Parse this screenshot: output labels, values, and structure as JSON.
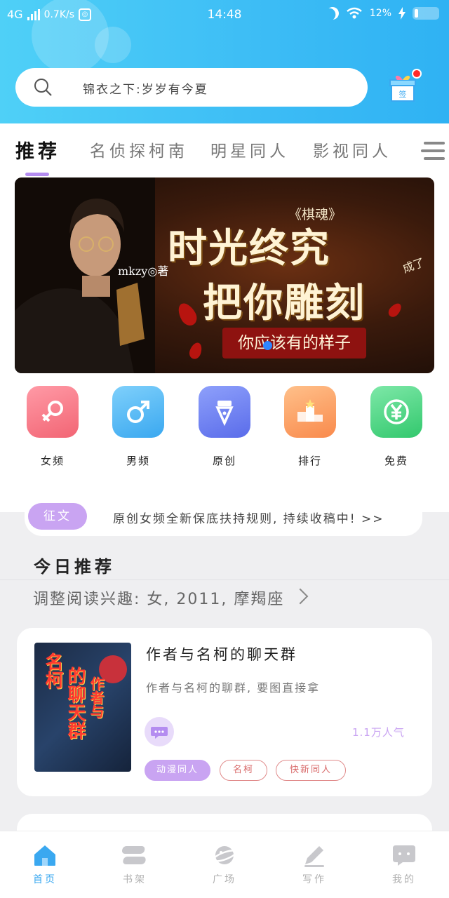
{
  "status_bar": {
    "network": "4G",
    "speed": "0.7K/s",
    "time": "14:48",
    "battery": "12%"
  },
  "search": {
    "placeholder": "锦衣之下:岁岁有今夏"
  },
  "tabs": [
    {
      "label": "推荐",
      "active": true
    },
    {
      "label": "名侦探柯南",
      "active": false
    },
    {
      "label": "明星同人",
      "active": false
    },
    {
      "label": "影视同人",
      "active": false
    }
  ],
  "banner": {
    "author": "mkzy◎著",
    "subtitle": "《棋魂》",
    "title_line1": "时光终究",
    "title_line2": "把你雕刻",
    "title_suffix": "成了",
    "tagline": "你应该有的样子"
  },
  "categories": [
    {
      "label": "女频",
      "icon": "female-icon",
      "color": "#f7707e"
    },
    {
      "label": "男频",
      "icon": "male-icon",
      "color": "#4db6f6"
    },
    {
      "label": "原创",
      "icon": "pen-nib-icon",
      "color": "#6d82f2"
    },
    {
      "label": "排行",
      "icon": "podium-icon",
      "color": "#fb9f61"
    },
    {
      "label": "免费",
      "icon": "yen-icon",
      "color": "#3fd37c"
    }
  ],
  "notice": {
    "badge": "征文",
    "text": "原创女频全新保底扶持规则, 持续收稿中!",
    "more": ">>"
  },
  "section": {
    "title": "今日推荐",
    "interest": "调整阅读兴趣: 女, 2011, 摩羯座"
  },
  "book": {
    "title": "作者与名柯的聊天群",
    "description": "作者与名柯的聊群, 要图直接拿",
    "popularity": "1.1万人气",
    "cover_text": [
      "名柯",
      "的聊天群",
      "作者与"
    ],
    "tags": [
      "动漫同人",
      "名柯",
      "快新同人"
    ]
  },
  "bottom_nav": [
    {
      "label": "首页",
      "active": true
    },
    {
      "label": "书架",
      "active": false
    },
    {
      "label": "广场",
      "active": false
    },
    {
      "label": "写作",
      "active": false
    },
    {
      "label": "我的",
      "active": false
    }
  ],
  "colors": {
    "header_blue": "#3cbcf5",
    "accent_purple": "#c9a4f2",
    "nav_active": "#3aa8f0"
  }
}
